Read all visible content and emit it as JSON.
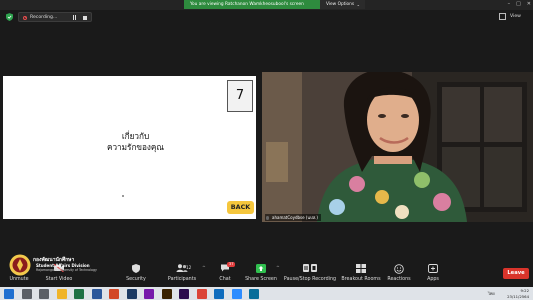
{
  "banner": {
    "viewing_text": "You are viewing Ratchanon Wamkheosubool's screen",
    "view_options_label": "View Options",
    "view_options_caret": "⌄"
  },
  "window_controls": {
    "minimize": "–",
    "maximize": "□",
    "close": "✕"
  },
  "recording": {
    "label": "Recording..."
  },
  "view_button": {
    "label": "View"
  },
  "slide": {
    "page_number": "7",
    "line1": "เกี่ยวกับ",
    "line2": "ความรักของคุณ",
    "back_label": "BACK"
  },
  "video": {
    "participant_name": "ahamatCoydbse (นปส.)"
  },
  "toolbar": {
    "unmute_label": "Unmute",
    "start_video_label": "Start Video",
    "security_label": "Security",
    "participants_label": "Participants",
    "participants_count": "12",
    "chat_label": "Chat",
    "chat_badge": "37",
    "share_label": "Share Screen",
    "record_label": "Pause/Stop Recording",
    "breakout_label": "Breakout Rooms",
    "reactions_label": "Reactions",
    "apps_label": "Apps",
    "leave_label": "Leave",
    "caret": "^"
  },
  "logo": {
    "thai_name": "กองพัฒนานักศึกษา",
    "english_name": "Student Affairs Division",
    "sub_text": "Rajamangala University of Technology"
  },
  "taskbar": {
    "language": "ไทย",
    "time": "9:22",
    "date": "23/11/2564",
    "apps": [
      {
        "name": "start-icon",
        "color": "#1f6fd0"
      },
      {
        "name": "search-icon",
        "color": "#5a5f66"
      },
      {
        "name": "task-view-icon",
        "color": "#5a5f66"
      },
      {
        "name": "file-explorer-icon",
        "color": "#f0b429"
      },
      {
        "name": "excel-icon",
        "color": "#1e7145"
      },
      {
        "name": "word-icon",
        "color": "#2b579a"
      },
      {
        "name": "powerpoint-icon",
        "color": "#d24726"
      },
      {
        "name": "photoshop-icon",
        "color": "#1c3a63"
      },
      {
        "name": "onenote-icon",
        "color": "#7719aa"
      },
      {
        "name": "illustrator-icon",
        "color": "#3a2200"
      },
      {
        "name": "premiere-icon",
        "color": "#2a0b4d"
      },
      {
        "name": "chrome-icon",
        "color": "#db4437"
      },
      {
        "name": "mail-icon",
        "color": "#0f6cbd"
      },
      {
        "name": "zoom-icon",
        "color": "#2d8cff"
      },
      {
        "name": "photos-icon",
        "color": "#0a6e9a"
      }
    ]
  },
  "colors": {
    "banner_green": "#2e8b3e",
    "back_button": "#f5c63d",
    "leave_button": "#d9342b",
    "share_green": "#30c04f"
  }
}
